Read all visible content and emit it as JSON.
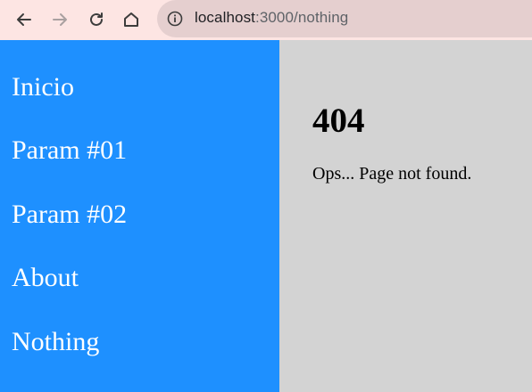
{
  "browser": {
    "url_host": "localhost",
    "url_rest": ":3000/nothing",
    "icons": [
      "back-arrow-icon",
      "forward-arrow-icon",
      "reload-icon",
      "home-icon",
      "info-icon"
    ]
  },
  "sidebar": {
    "items": [
      {
        "label": "Inicio"
      },
      {
        "label": "Param #01"
      },
      {
        "label": "Param #02"
      },
      {
        "label": "About"
      },
      {
        "label": "Nothing"
      }
    ],
    "background": "#1e90ff"
  },
  "main": {
    "title": "404",
    "message": "Ops... Page not found.",
    "background": "#d3d3d3"
  }
}
